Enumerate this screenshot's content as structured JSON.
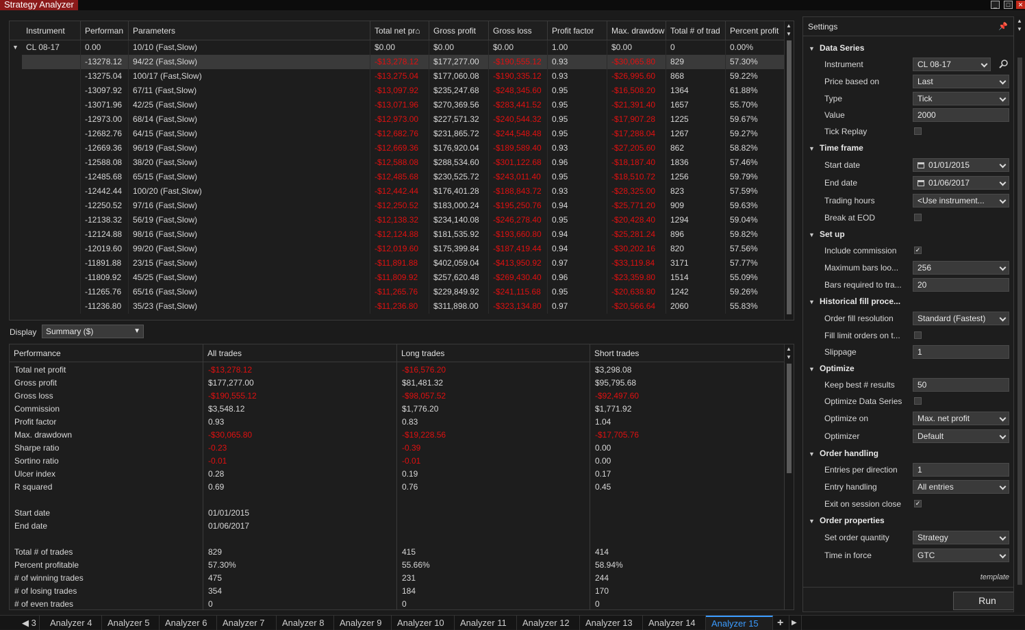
{
  "window": {
    "title": "Strategy Analyzer"
  },
  "grid": {
    "columns": [
      "Instrument",
      "Performan",
      "Parameters",
      "Total net pr⌂",
      "Gross profit",
      "Gross loss",
      "Profit factor",
      "Max. drawdow",
      "Total # of trad",
      "Percent profit"
    ],
    "parent": {
      "instrument": "CL 08-17",
      "performance": "0.00",
      "parameters": "10/10 (Fast,Slow)",
      "net": "$0.00",
      "gross_profit": "$0.00",
      "gross_loss": "$0.00",
      "pf": "1.00",
      "dd": "$0.00",
      "trades": "0",
      "pct": "0.00%"
    },
    "rows": [
      {
        "perf": "-13278.12",
        "params": "94/22 (Fast,Slow)",
        "net": "-$13,278.12",
        "gp": "$177,277.00",
        "gl": "-$190,555.12",
        "pf": "0.93",
        "dd": "-$30,065.80",
        "trades": "829",
        "pct": "57.30%"
      },
      {
        "perf": "-13275.04",
        "params": "100/17 (Fast,Slow)",
        "net": "-$13,275.04",
        "gp": "$177,060.08",
        "gl": "-$190,335.12",
        "pf": "0.93",
        "dd": "-$26,995.60",
        "trades": "868",
        "pct": "59.22%"
      },
      {
        "perf": "-13097.92",
        "params": "67/11 (Fast,Slow)",
        "net": "-$13,097.92",
        "gp": "$235,247.68",
        "gl": "-$248,345.60",
        "pf": "0.95",
        "dd": "-$16,508.20",
        "trades": "1364",
        "pct": "61.88%"
      },
      {
        "perf": "-13071.96",
        "params": "42/25 (Fast,Slow)",
        "net": "-$13,071.96",
        "gp": "$270,369.56",
        "gl": "-$283,441.52",
        "pf": "0.95",
        "dd": "-$21,391.40",
        "trades": "1657",
        "pct": "55.70%"
      },
      {
        "perf": "-12973.00",
        "params": "68/14 (Fast,Slow)",
        "net": "-$12,973.00",
        "gp": "$227,571.32",
        "gl": "-$240,544.32",
        "pf": "0.95",
        "dd": "-$17,907.28",
        "trades": "1225",
        "pct": "59.67%"
      },
      {
        "perf": "-12682.76",
        "params": "64/15 (Fast,Slow)",
        "net": "-$12,682.76",
        "gp": "$231,865.72",
        "gl": "-$244,548.48",
        "pf": "0.95",
        "dd": "-$17,288.04",
        "trades": "1267",
        "pct": "59.27%"
      },
      {
        "perf": "-12669.36",
        "params": "96/19 (Fast,Slow)",
        "net": "-$12,669.36",
        "gp": "$176,920.04",
        "gl": "-$189,589.40",
        "pf": "0.93",
        "dd": "-$27,205.60",
        "trades": "862",
        "pct": "58.82%"
      },
      {
        "perf": "-12588.08",
        "params": "38/20 (Fast,Slow)",
        "net": "-$12,588.08",
        "gp": "$288,534.60",
        "gl": "-$301,122.68",
        "pf": "0.96",
        "dd": "-$18,187.40",
        "trades": "1836",
        "pct": "57.46%"
      },
      {
        "perf": "-12485.68",
        "params": "65/15 (Fast,Slow)",
        "net": "-$12,485.68",
        "gp": "$230,525.72",
        "gl": "-$243,011.40",
        "pf": "0.95",
        "dd": "-$18,510.72",
        "trades": "1256",
        "pct": "59.79%"
      },
      {
        "perf": "-12442.44",
        "params": "100/20 (Fast,Slow)",
        "net": "-$12,442.44",
        "gp": "$176,401.28",
        "gl": "-$188,843.72",
        "pf": "0.93",
        "dd": "-$28,325.00",
        "trades": "823",
        "pct": "57.59%"
      },
      {
        "perf": "-12250.52",
        "params": "97/16 (Fast,Slow)",
        "net": "-$12,250.52",
        "gp": "$183,000.24",
        "gl": "-$195,250.76",
        "pf": "0.94",
        "dd": "-$25,771.20",
        "trades": "909",
        "pct": "59.63%"
      },
      {
        "perf": "-12138.32",
        "params": "56/19 (Fast,Slow)",
        "net": "-$12,138.32",
        "gp": "$234,140.08",
        "gl": "-$246,278.40",
        "pf": "0.95",
        "dd": "-$20,428.40",
        "trades": "1294",
        "pct": "59.04%"
      },
      {
        "perf": "-12124.88",
        "params": "98/16 (Fast,Slow)",
        "net": "-$12,124.88",
        "gp": "$181,535.92",
        "gl": "-$193,660.80",
        "pf": "0.94",
        "dd": "-$25,281.24",
        "trades": "896",
        "pct": "59.82%"
      },
      {
        "perf": "-12019.60",
        "params": "99/20 (Fast,Slow)",
        "net": "-$12,019.60",
        "gp": "$175,399.84",
        "gl": "-$187,419.44",
        "pf": "0.94",
        "dd": "-$30,202.16",
        "trades": "820",
        "pct": "57.56%"
      },
      {
        "perf": "-11891.88",
        "params": "23/15 (Fast,Slow)",
        "net": "-$11,891.88",
        "gp": "$402,059.04",
        "gl": "-$413,950.92",
        "pf": "0.97",
        "dd": "-$33,119.84",
        "trades": "3171",
        "pct": "57.77%"
      },
      {
        "perf": "-11809.92",
        "params": "45/25 (Fast,Slow)",
        "net": "-$11,809.92",
        "gp": "$257,620.48",
        "gl": "-$269,430.40",
        "pf": "0.96",
        "dd": "-$23,359.80",
        "trades": "1514",
        "pct": "55.09%"
      },
      {
        "perf": "-11265.76",
        "params": "65/16 (Fast,Slow)",
        "net": "-$11,265.76",
        "gp": "$229,849.92",
        "gl": "-$241,115.68",
        "pf": "0.95",
        "dd": "-$20,638.80",
        "trades": "1242",
        "pct": "59.26%"
      },
      {
        "perf": "-11236.80",
        "params": "35/23 (Fast,Slow)",
        "net": "-$11,236.80",
        "gp": "$311,898.00",
        "gl": "-$323,134.80",
        "pf": "0.97",
        "dd": "-$20,566.64",
        "trades": "2060",
        "pct": "55.83%"
      }
    ]
  },
  "display": {
    "label": "Display",
    "value": "Summary ($)"
  },
  "performance": {
    "columns": [
      "Performance",
      "All trades",
      "Long trades",
      "Short trades"
    ],
    "rows": [
      {
        "label": "Total net profit",
        "all": "-$13,278.12",
        "long": "-$16,576.20",
        "short": "$3,298.08"
      },
      {
        "label": "Gross profit",
        "all": "$177,277.00",
        "long": "$81,481.32",
        "short": "$95,795.68"
      },
      {
        "label": "Gross loss",
        "all": "-$190,555.12",
        "long": "-$98,057.52",
        "short": "-$92,497.60"
      },
      {
        "label": "Commission",
        "all": "$3,548.12",
        "long": "$1,776.20",
        "short": "$1,771.92"
      },
      {
        "label": "Profit factor",
        "all": "0.93",
        "long": "0.83",
        "short": "1.04"
      },
      {
        "label": "Max. drawdown",
        "all": "-$30,065.80",
        "long": "-$19,228.56",
        "short": "-$17,705.76"
      },
      {
        "label": "Sharpe ratio",
        "all": "-0.23",
        "long": "-0.39",
        "short": "0.00"
      },
      {
        "label": "Sortino ratio",
        "all": "-0.01",
        "long": "-0.01",
        "short": "0.00"
      },
      {
        "label": "Ulcer index",
        "all": "0.28",
        "long": "0.19",
        "short": "0.17"
      },
      {
        "label": "R squared",
        "all": "0.69",
        "long": "0.76",
        "short": "0.45"
      },
      {
        "label": "",
        "all": "",
        "long": "",
        "short": ""
      },
      {
        "label": "Start date",
        "all": "01/01/2015",
        "long": "",
        "short": ""
      },
      {
        "label": "End date",
        "all": "01/06/2017",
        "long": "",
        "short": ""
      },
      {
        "label": "",
        "all": "",
        "long": "",
        "short": ""
      },
      {
        "label": "Total # of trades",
        "all": "829",
        "long": "415",
        "short": "414"
      },
      {
        "label": "Percent profitable",
        "all": "57.30%",
        "long": "55.66%",
        "short": "58.94%"
      },
      {
        "label": "# of winning trades",
        "all": "475",
        "long": "231",
        "short": "244"
      },
      {
        "label": "# of losing trades",
        "all": "354",
        "long": "184",
        "short": "170"
      },
      {
        "label": "# of even trades",
        "all": "0",
        "long": "0",
        "short": "0"
      }
    ]
  },
  "settings": {
    "title": "Settings",
    "sections": {
      "data_series": "Data Series",
      "time_frame": "Time frame",
      "setup": "Set up",
      "historical": "Historical fill proce...",
      "optimize": "Optimize",
      "order_handling": "Order handling",
      "order_properties": "Order properties"
    },
    "fields": {
      "instrument": {
        "label": "Instrument",
        "value": "CL 08-17"
      },
      "price_based_on": {
        "label": "Price based on",
        "value": "Last"
      },
      "type": {
        "label": "Type",
        "value": "Tick"
      },
      "value": {
        "label": "Value",
        "value": "2000"
      },
      "tick_replay": {
        "label": "Tick Replay",
        "checked": false
      },
      "start_date": {
        "label": "Start date",
        "value": "01/01/2015"
      },
      "end_date": {
        "label": "End date",
        "value": "01/06/2017"
      },
      "trading_hours": {
        "label": "Trading hours",
        "value": "<Use instrument..."
      },
      "break_eod": {
        "label": "Break at EOD",
        "checked": false
      },
      "include_commission": {
        "label": "Include commission",
        "checked": true
      },
      "max_bars": {
        "label": "Maximum bars loo...",
        "value": "256"
      },
      "bars_required": {
        "label": "Bars required to tra...",
        "value": "20"
      },
      "order_fill": {
        "label": "Order fill resolution",
        "value": "Standard (Fastest)"
      },
      "fill_limit": {
        "label": "Fill limit orders on t...",
        "checked": false
      },
      "slippage": {
        "label": "Slippage",
        "value": "1"
      },
      "keep_best": {
        "label": "Keep best # results",
        "value": "50"
      },
      "optimize_ds": {
        "label": "Optimize Data Series",
        "checked": false
      },
      "optimize_on": {
        "label": "Optimize on",
        "value": "Max. net profit"
      },
      "optimizer": {
        "label": "Optimizer",
        "value": "Default"
      },
      "entries_per_dir": {
        "label": "Entries per direction",
        "value": "1"
      },
      "entry_handling": {
        "label": "Entry handling",
        "value": "All entries"
      },
      "exit_session": {
        "label": "Exit on session close",
        "checked": true
      },
      "set_order_qty": {
        "label": "Set order quantity",
        "value": "Strategy"
      },
      "time_in_force": {
        "label": "Time in force",
        "value": "GTC"
      }
    },
    "template_link": "template",
    "run_label": "Run"
  },
  "tabs": {
    "prev_label": "3",
    "items": [
      "Analyzer 4",
      "Analyzer 5",
      "Analyzer 6",
      "Analyzer 7",
      "Analyzer 8",
      "Analyzer 9",
      "Analyzer 10",
      "Analyzer 11",
      "Analyzer 12",
      "Analyzer 13",
      "Analyzer 14",
      "Analyzer 15"
    ],
    "active": "Analyzer 15"
  },
  "colors": {
    "negative": "#e01010",
    "accent": "#3b9cff",
    "title_bg": "#8b1a1a"
  }
}
